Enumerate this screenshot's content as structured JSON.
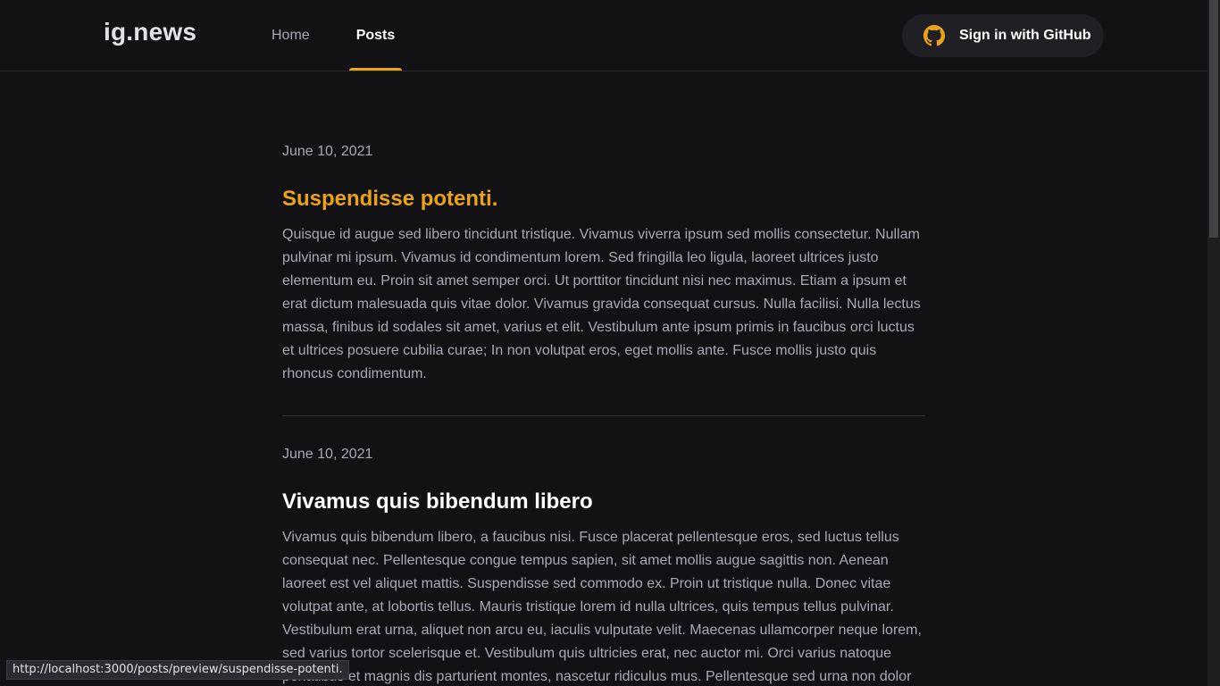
{
  "header": {
    "logo": "ig.news",
    "nav": [
      {
        "label": "Home",
        "active": false
      },
      {
        "label": "Posts",
        "active": true
      }
    ],
    "signin_label": "Sign in with GitHub",
    "signin_icon": "github-icon",
    "accent_color": "#eba417"
  },
  "posts": [
    {
      "date": "June 10, 2021",
      "title": "Suspendisse potenti.",
      "excerpt": "Quisque id augue sed libero tincidunt tristique. Vivamus viverra ipsum sed mollis consectetur. Nullam pulvinar mi ipsum. Vivamus id condimentum lorem. Sed fringilla leo ligula, laoreet ultrices justo elementum eu. Proin sit amet semper orci. Ut porttitor tincidunt nisi nec maximus. Etiam a ipsum et erat dictum malesuada quis vitae dolor. Vivamus gravida consequat cursus. Nulla facilisi. Nulla lectus massa, finibus id sodales sit amet, varius et elit. Vestibulum ante ipsum primis in faucibus orci luctus et ultrices posuere cubilia curae; In non volutpat eros, eget mollis ante. Fusce mollis justo quis rhoncus condimentum."
    },
    {
      "date": "June 10, 2021",
      "title": "Vivamus quis bibendum libero",
      "excerpt": "Vivamus quis bibendum libero, a faucibus nisi. Fusce placerat pellentesque eros, sed luctus tellus consequat nec. Pellentesque congue tempus sapien, sit amet mollis augue sagittis non. Aenean laoreet est vel aliquet mattis. Suspendisse sed commodo ex. Proin ut tristique nulla. Donec vitae volutpat ante, at lobortis tellus. Mauris tristique lorem id nulla ultrices, quis tempus tellus pulvinar. Vestibulum erat urna, aliquet non arcu eu, iaculis vulputate velit. Maecenas ullamcorper neque lorem, sed varius tortor scelerisque et. Vestibulum quis ultricies erat, nec auctor mi. Orci varius natoque penatibus et magnis dis parturient montes, nascetur ridiculus mus. Pellentesque sed urna non dolor hendrerit posuere. Integer lobortis ullamcorper nunc eget sollicitudin. Integer non nisi feugiat,"
    }
  ],
  "status_url": "http://localhost:3000/posts/preview/suspendisse-potenti."
}
